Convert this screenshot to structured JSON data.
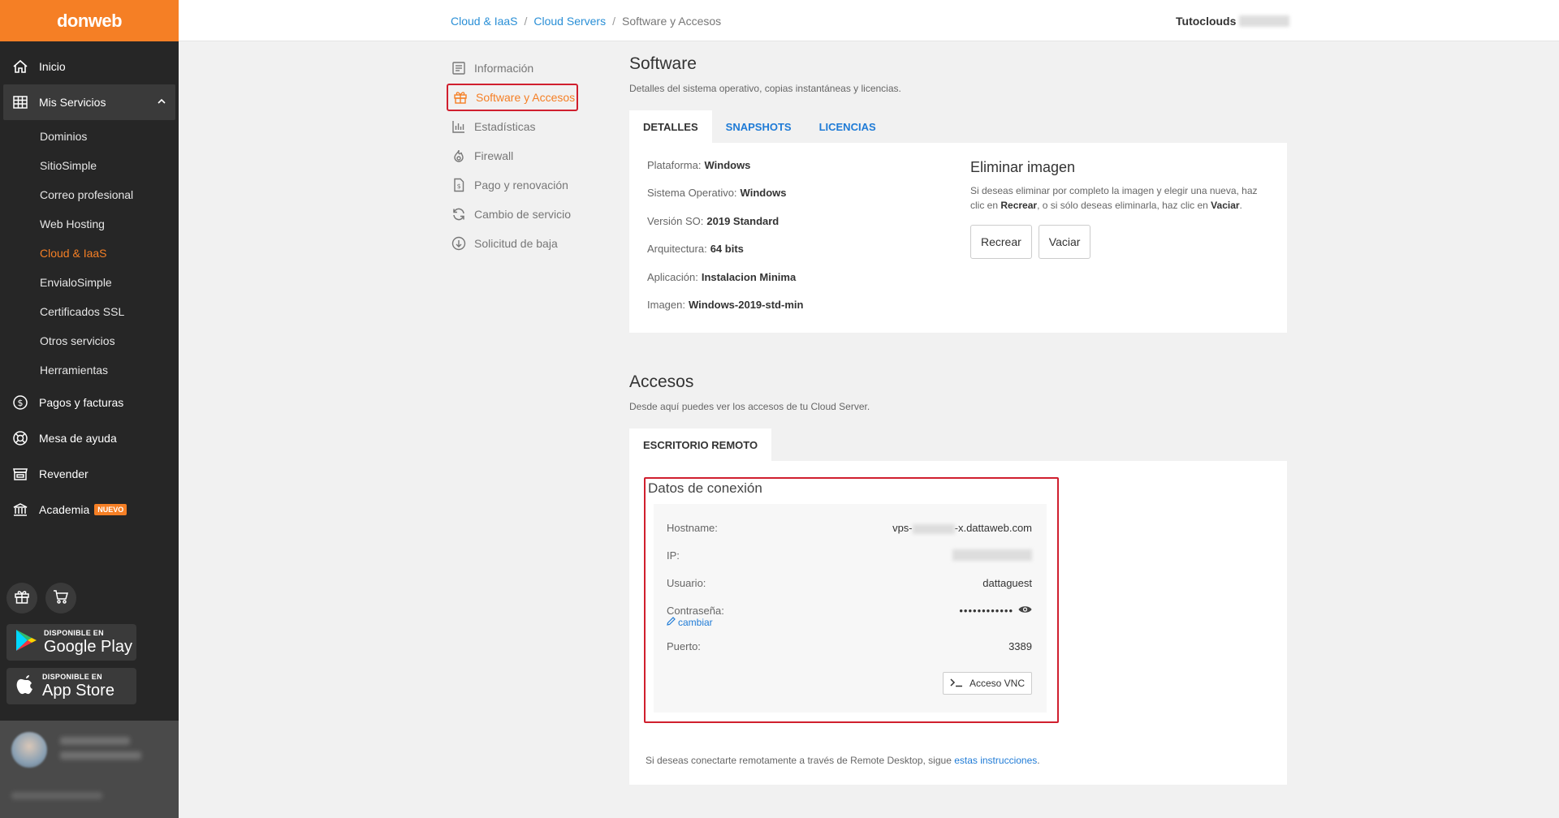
{
  "brand": {
    "logo_text": "donweb",
    "accent": "#f57f25"
  },
  "sidebar": {
    "inicio": "Inicio",
    "mis_servicios": "Mis Servicios",
    "sub_items": [
      "Dominios",
      "SitioSimple",
      "Correo profesional",
      "Web Hosting",
      "Cloud & IaaS",
      "EnvialoSimple",
      "Certificados SSL",
      "Otros servicios",
      "Herramientas"
    ],
    "pagos": "Pagos y facturas",
    "mesa": "Mesa de ayuda",
    "revender": "Revender",
    "academia": "Academia",
    "academia_badge": "NUEVO",
    "google_play": {
      "small": "DISPONIBLE EN",
      "big": "Google Play"
    },
    "app_store": {
      "small": "DISPONIBLE EN",
      "big": "App Store"
    }
  },
  "header": {
    "breadcrumb": [
      "Cloud & IaaS",
      "Cloud Servers",
      "Software y Accesos"
    ],
    "account": "Tutoclouds"
  },
  "submenu": [
    "Información",
    "Software y Accesos",
    "Estadísticas",
    "Firewall",
    "Pago y renovación",
    "Cambio de servicio",
    "Solicitud de baja"
  ],
  "software": {
    "title": "Software",
    "description": "Detalles del sistema operativo, copias instantáneas y licencias.",
    "tabs": [
      "DETALLES",
      "SNAPSHOTS",
      "LICENCIAS"
    ],
    "details": [
      {
        "label": "Plataforma:",
        "value": "Windows"
      },
      {
        "label": "Sistema Operativo:",
        "value": "Windows"
      },
      {
        "label": "Versión SO:",
        "value": "2019 Standard"
      },
      {
        "label": "Arquitectura:",
        "value": "64 bits"
      },
      {
        "label": "Aplicación:",
        "value": "Instalacion Minima"
      },
      {
        "label": "Imagen:",
        "value": "Windows-2019-std-min"
      }
    ],
    "eliminar": {
      "title": "Eliminar imagen",
      "text_1": "Si deseas eliminar por completo la imagen y elegir una nueva, haz clic en ",
      "recrear_bold": "Recrear",
      "text_2": ", o si sólo deseas eliminarla, haz clic en ",
      "vaciar_bold": "Vaciar",
      "text_3": ".",
      "btn_recrear": "Recrear",
      "btn_vaciar": "Vaciar"
    }
  },
  "accesos": {
    "title": "Accesos",
    "description": "Desde aquí puedes ver los accesos de tu Cloud Server.",
    "tab": "ESCRITORIO REMOTO",
    "conn_title": "Datos de conexión",
    "hostname_label": "Hostname:",
    "hostname_prefix": "vps-",
    "hostname_suffix": "-x.dattaweb.com",
    "ip_label": "IP:",
    "usuario_label": "Usuario:",
    "usuario_value": "dattaguest",
    "password_label": "Contraseña:",
    "password_value": "••••••••••••",
    "cambiar": "cambiar",
    "puerto_label": "Puerto:",
    "puerto_value": "3389",
    "vnc_button": "Acceso VNC",
    "footer_text": "Si deseas conectarte remotamente a través de Remote Desktop, sigue ",
    "footer_link": "estas instrucciones",
    "footer_end": "."
  }
}
